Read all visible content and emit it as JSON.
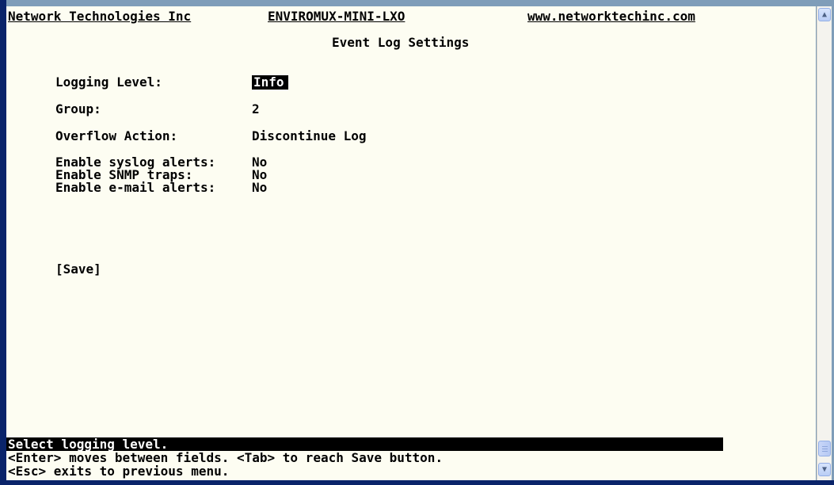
{
  "header": {
    "company": "Network Technologies Inc",
    "model": "ENVIROMUX-MINI-LXO",
    "website": "www.networktechinc.com"
  },
  "title": "Event Log Settings",
  "fields": {
    "logging_level": {
      "label": "Logging Level:",
      "value": "Info"
    },
    "group": {
      "label": "Group:",
      "value": "2"
    },
    "overflow_action": {
      "label": "Overflow Action:",
      "value": "Discontinue Log"
    },
    "syslog": {
      "label": "Enable syslog alerts:",
      "value": "No"
    },
    "snmp": {
      "label": "Enable SNMP traps:",
      "value": "No"
    },
    "email": {
      "label": "Enable e-mail alerts:",
      "value": "No"
    }
  },
  "save_label": "[Save]",
  "status": "Select logging level.",
  "help": [
    "<Enter> moves between fields. <Tab> to reach Save button.",
    "<Esc> exits to previous menu."
  ],
  "scrollbar": {
    "up_icon": "chevron-up-icon",
    "down_icon": "chevron-down-icon"
  }
}
